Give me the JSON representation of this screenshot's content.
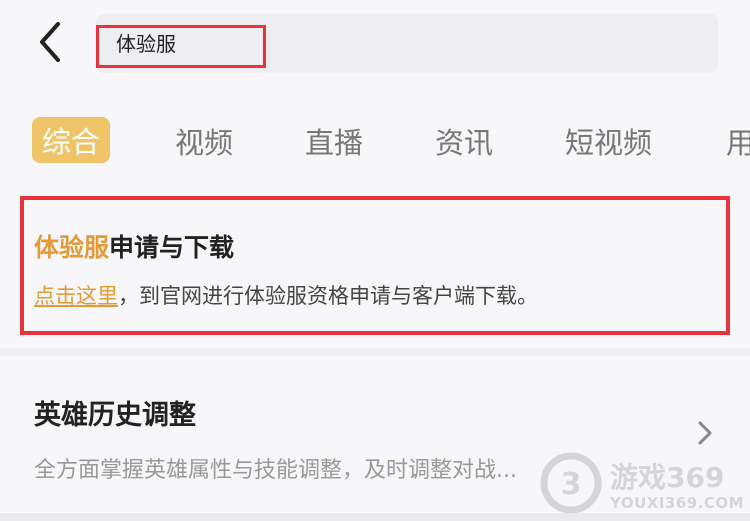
{
  "search": {
    "query": "体验服"
  },
  "tabs": [
    {
      "label": "综合",
      "active": true
    },
    {
      "label": "视频",
      "active": false
    },
    {
      "label": "直播",
      "active": false
    },
    {
      "label": "资讯",
      "active": false
    },
    {
      "label": "短视频",
      "active": false
    },
    {
      "label": "用",
      "active": false
    }
  ],
  "result_card": {
    "title_keyword": "体验服",
    "title_rest": "申请与下载",
    "link_text": "点击这里",
    "desc_rest": "，到官网进行体验服资格申请与客户端下载。"
  },
  "list_item": {
    "title": "英雄历史调整",
    "desc": "全方面掌握英雄属性与技能调整，及时调整对战..."
  },
  "watermark": {
    "brand": "游戏369",
    "domain": "YOUXI369.COM"
  },
  "colors": {
    "accent": "#f0c56a",
    "keyword": "#e39b3a",
    "highlight_border": "#e8323c"
  }
}
